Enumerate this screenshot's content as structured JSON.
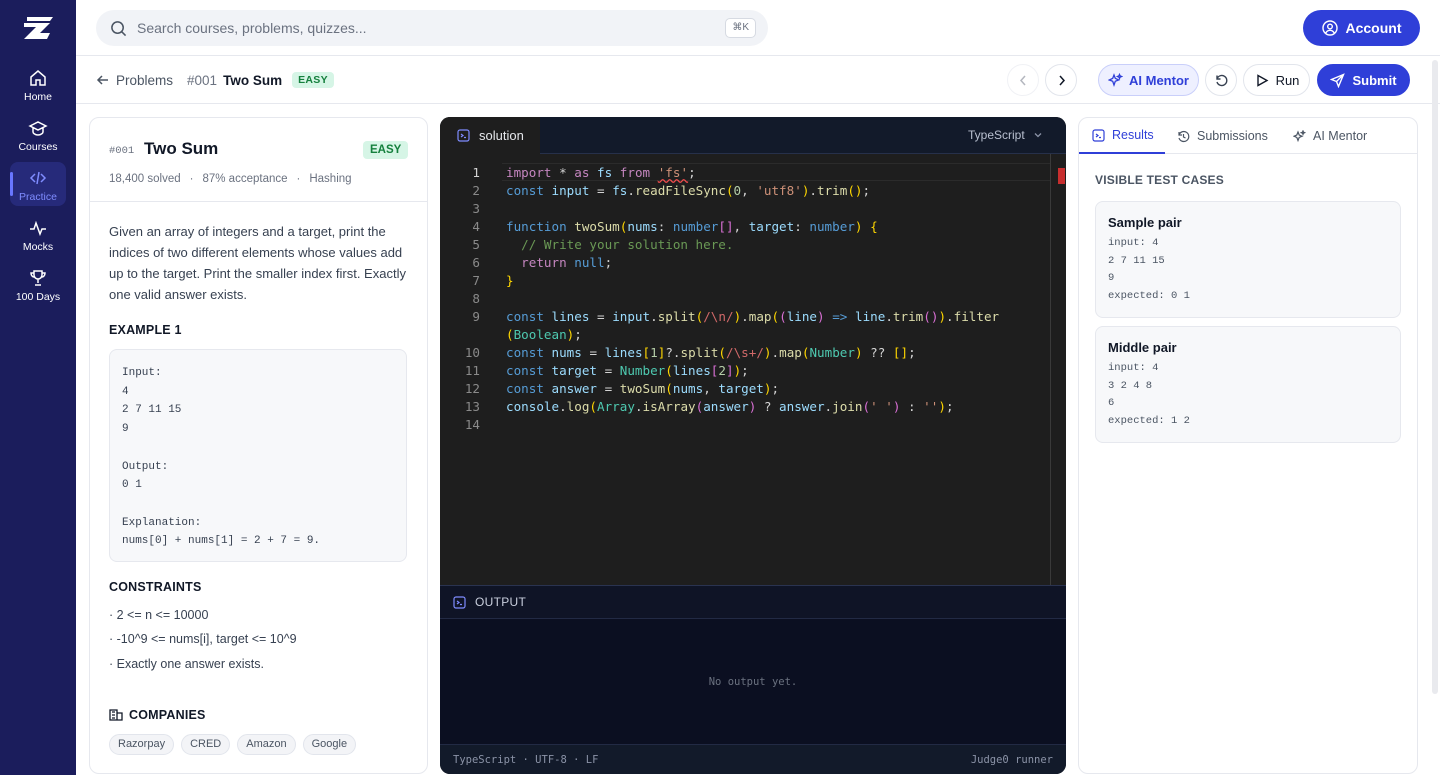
{
  "sidebar": {
    "items": [
      {
        "label": "Home",
        "icon": "home-icon"
      },
      {
        "label": "Courses",
        "icon": "courses-icon"
      },
      {
        "label": "Practice",
        "icon": "code-icon",
        "active": true
      },
      {
        "label": "Mocks",
        "icon": "activity-icon"
      },
      {
        "label": "100 Days",
        "icon": "trophy-icon"
      }
    ]
  },
  "header": {
    "search_placeholder": "Search courses, problems, quizzes...",
    "search_shortcut": "⌘K",
    "account_label": "Account"
  },
  "toolbar": {
    "back_label": "Problems",
    "problem_number": "#001",
    "problem_title": "Two Sum",
    "difficulty": "EASY",
    "ai_mentor_label": "AI Mentor",
    "run_label": "Run",
    "submit_label": "Submit"
  },
  "problem": {
    "number": "#001",
    "title": "Two Sum",
    "difficulty": "EASY",
    "solved": "18,400 solved",
    "acceptance": "87% acceptance",
    "topic": "Hashing",
    "description": "Given an array of integers and a target, print the indices of two different elements whose values add up to the target. Print the smaller index first. Exactly one valid answer exists.",
    "example_title": "EXAMPLE 1",
    "example_text": "Input:\n4\n2 7 11 15\n9\n\nOutput:\n0 1\n\nExplanation:\nnums[0] + nums[1] = 2 + 7 = 9.",
    "constraints_title": "CONSTRAINTS",
    "constraints": [
      "· 2 <= n <= 10000",
      "· -10^9 <= nums[i], target <= 10^9",
      "· Exactly one answer exists."
    ],
    "companies_title": "COMPANIES",
    "companies": [
      "Razorpay",
      "CRED",
      "Amazon",
      "Google"
    ]
  },
  "editor": {
    "tab_label": "solution",
    "language": "TypeScript",
    "line_numbers": [
      "1",
      "2",
      "3",
      "4",
      "5",
      "6",
      "7",
      "8",
      "9",
      "",
      "10",
      "11",
      "12",
      "13",
      "14"
    ],
    "output_title": "OUTPUT",
    "output_placeholder": "No output yet.",
    "status_left": "TypeScript · UTF-8 · LF",
    "status_right": "Judge0 runner"
  },
  "results": {
    "tabs": [
      "Results",
      "Submissions",
      "AI Mentor"
    ],
    "section_title": "VISIBLE TEST CASES",
    "cases": [
      {
        "name": "Sample pair",
        "body": "input: 4\n2 7 11 15\n9\nexpected: 0 1"
      },
      {
        "name": "Middle pair",
        "body": "input: 4\n3 2 4 8\n6\nexpected: 1 2"
      }
    ]
  },
  "colors": {
    "sidebar_bg": "#1b1d5c",
    "accent": "#2f3fd8",
    "easy_badge": "#15803d",
    "editor_bg": "#1e1e1e"
  }
}
